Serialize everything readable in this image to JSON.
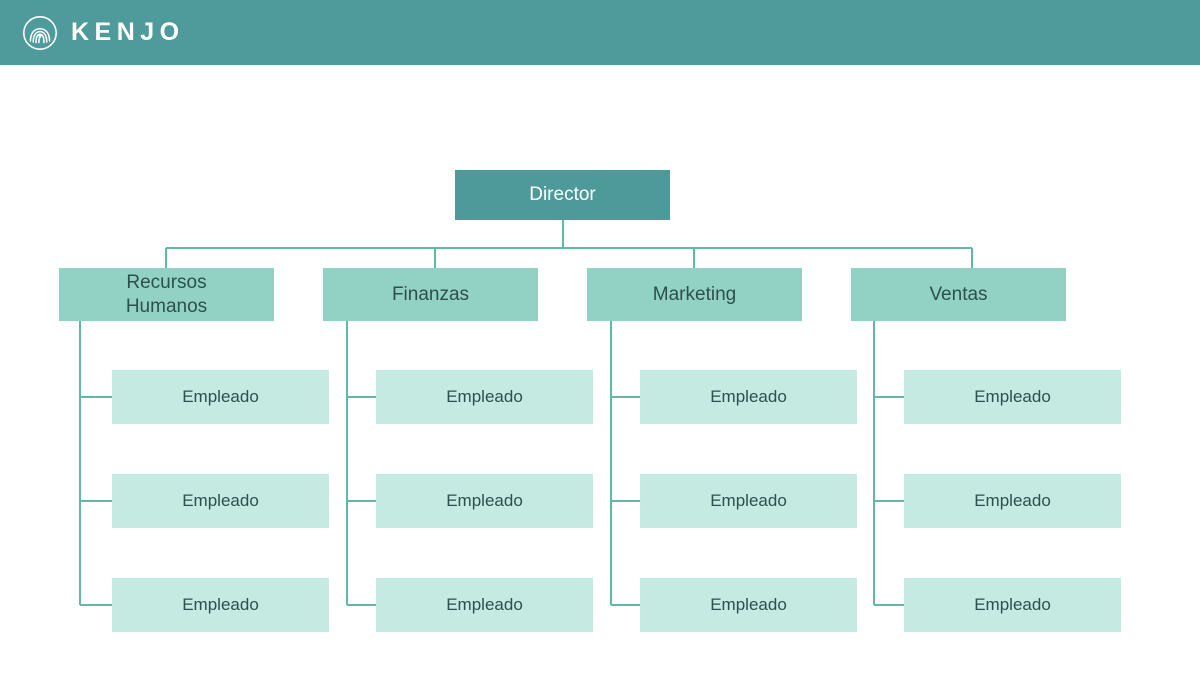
{
  "header": {
    "brand": "KENJO",
    "logo_icon": "kenjo-fingerprint-logo",
    "background_color": "#4f9a9b"
  },
  "colors": {
    "header": "#4f9a9b",
    "root_box": "#4e9a9a",
    "department_box": "#92d2c5",
    "employee_box": "#c5eae2",
    "connector_line": "#5fb8a8",
    "dark_text": "#2d4f4d",
    "light_text": "#ffffff",
    "canvas": "#ffffff"
  },
  "chart_data": {
    "type": "diagram",
    "diagram_type": "organizational-chart",
    "title": "",
    "root": {
      "id": "director",
      "label": "Director",
      "level": 0
    },
    "departments": [
      {
        "id": "recursos-humanos",
        "label": "Recursos Humanos",
        "label_lines": [
          "Recursos",
          "Humanos"
        ],
        "level": 1,
        "employees": [
          {
            "id": "rh-emp-1",
            "label": "Empleado"
          },
          {
            "id": "rh-emp-2",
            "label": "Empleado"
          },
          {
            "id": "rh-emp-3",
            "label": "Empleado"
          }
        ]
      },
      {
        "id": "finanzas",
        "label": "Finanzas",
        "label_lines": [
          "Finanzas"
        ],
        "level": 1,
        "employees": [
          {
            "id": "fi-emp-1",
            "label": "Empleado"
          },
          {
            "id": "fi-emp-2",
            "label": "Empleado"
          },
          {
            "id": "fi-emp-3",
            "label": "Empleado"
          }
        ]
      },
      {
        "id": "marketing",
        "label": "Marketing",
        "label_lines": [
          "Marketing"
        ],
        "level": 1,
        "employees": [
          {
            "id": "mk-emp-1",
            "label": "Empleado"
          },
          {
            "id": "mk-emp-2",
            "label": "Empleado"
          },
          {
            "id": "mk-emp-3",
            "label": "Empleado"
          }
        ]
      },
      {
        "id": "ventas",
        "label": "Ventas",
        "label_lines": [
          "Ventas"
        ],
        "level": 1,
        "employees": [
          {
            "id": "ve-emp-1",
            "label": "Empleado"
          },
          {
            "id": "ve-emp-2",
            "label": "Empleado"
          },
          {
            "id": "ve-emp-3",
            "label": "Empleado"
          }
        ]
      }
    ],
    "counts": {
      "levels": 3,
      "departments": 4,
      "employees_per_department": 3,
      "total_employees": 12
    }
  }
}
